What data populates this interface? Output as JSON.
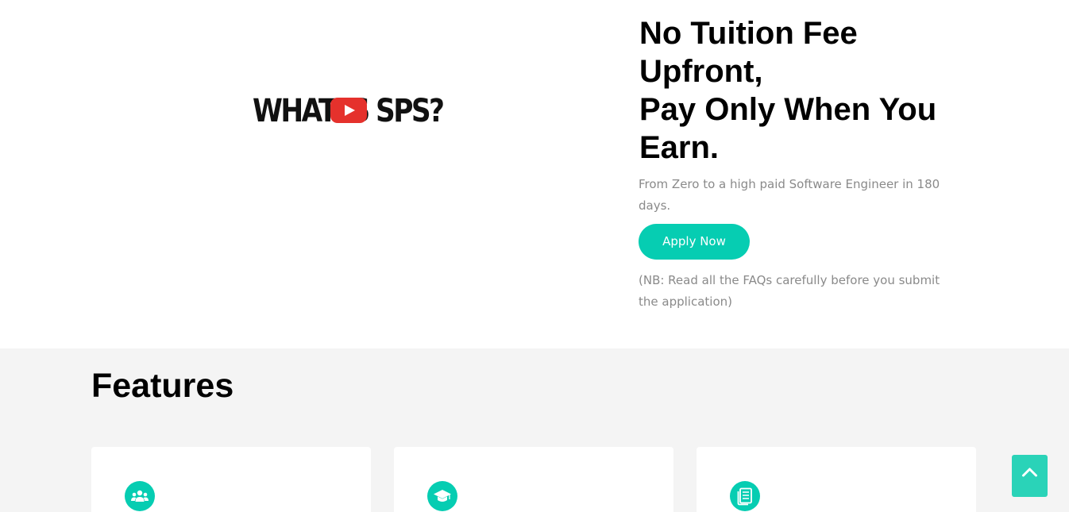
{
  "video": {
    "title": "WHAT IS SPS?",
    "play_icon": "youtube-play-icon"
  },
  "hero": {
    "title_lines": [
      "No Tuition Fee",
      "Upfront,",
      "Pay Only When You",
      "Earn."
    ],
    "subtitle": "From Zero to a high paid Software Engineer in 180 days.",
    "apply_label": "Apply Now",
    "note": "(NB: Read all the FAQs carefully before you submit the application)"
  },
  "features": {
    "title": "Features",
    "cards": [
      {
        "icon": "users-group-icon"
      },
      {
        "icon": "graduation-cap-icon"
      },
      {
        "icon": "document-list-icon"
      }
    ]
  },
  "back_to_top": {
    "icon": "chevron-up-icon"
  },
  "colors": {
    "accent": "#06cdb2",
    "muted_text": "#8a8a8a",
    "section_bg": "#f4f4f4",
    "youtube_red": "#e5312c"
  }
}
